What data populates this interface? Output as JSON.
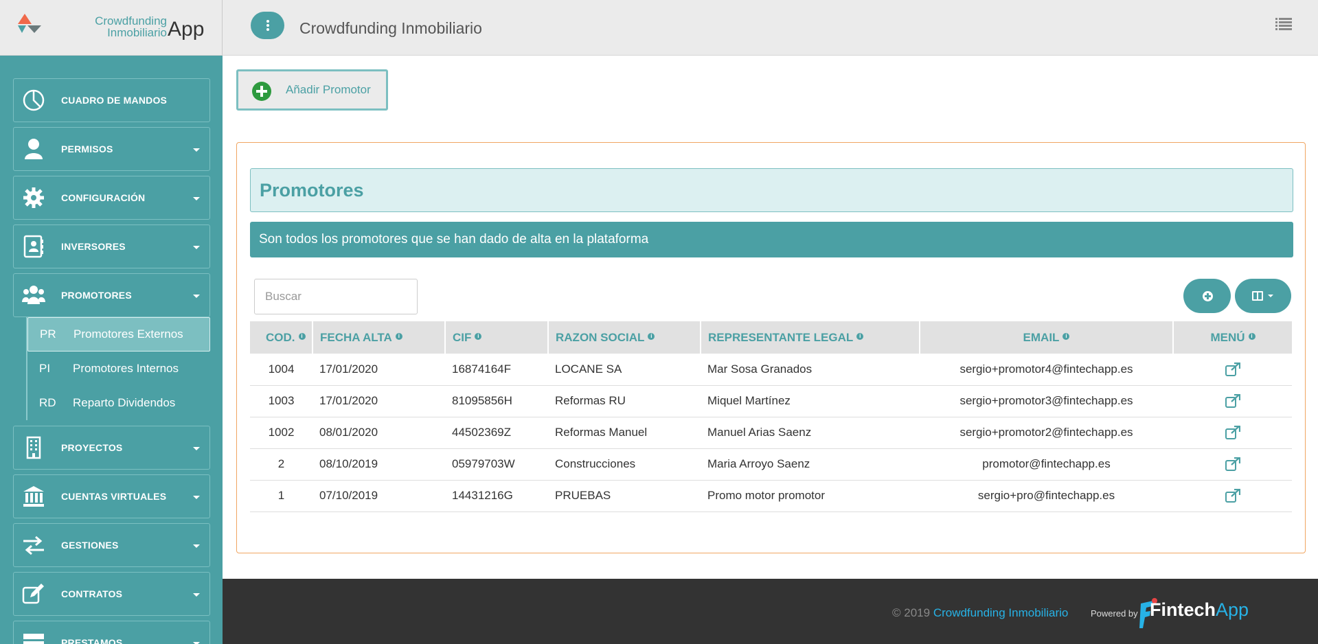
{
  "brand": {
    "line1": "Crowdfunding",
    "line2": "Inmobiliario",
    "app": "App"
  },
  "topbar": {
    "title": "Crowdfunding Inmobiliario"
  },
  "sidebar": {
    "items": [
      {
        "label": "CUADRO DE MANDOS",
        "icon": "dashboard-icon"
      },
      {
        "label": "PERMISOS",
        "icon": "user-icon"
      },
      {
        "label": "CONFIGURACIÓN",
        "icon": "gear-icon"
      },
      {
        "label": "INVERSORES",
        "icon": "contact-book-icon"
      },
      {
        "label": "PROMOTORES",
        "icon": "users-icon"
      },
      {
        "label": "PROYECTOS",
        "icon": "building-icon"
      },
      {
        "label": "CUENTAS VIRTUALES",
        "icon": "bank-icon"
      },
      {
        "label": "GESTIONES",
        "icon": "exchange-icon"
      },
      {
        "label": "CONTRATOS",
        "icon": "edit-icon"
      },
      {
        "label": "PRESTAMOS",
        "icon": "server-icon"
      }
    ],
    "sub_items": [
      {
        "abbr": "PR",
        "label": "Promotores Externos",
        "active": true
      },
      {
        "abbr": "PI",
        "label": "Promotores Internos",
        "active": false
      },
      {
        "abbr": "RD",
        "label": "Reparto Dividendos",
        "active": false
      }
    ]
  },
  "main": {
    "add_button": "Añadir Promotor",
    "card_title": "Promotores",
    "card_subtitle": "Son todos los promotores que se han dado de alta en la plataforma",
    "search_placeholder": "Buscar",
    "columns": [
      "COD.",
      "FECHA ALTA",
      "CIF",
      "RAZON SOCIAL",
      "REPRESENTANTE LEGAL",
      "EMAIL",
      "MENÚ"
    ],
    "rows": [
      {
        "cod": "1004",
        "fecha": "17/01/2020",
        "cif": "16874164F",
        "razon": "LOCANE SA",
        "rep": "Mar Sosa Granados",
        "email": "sergio+promotor4@fintechapp.es"
      },
      {
        "cod": "1003",
        "fecha": "17/01/2020",
        "cif": "81095856H",
        "razon": "Reformas RU",
        "rep": "Miquel Martínez",
        "email": "sergio+promotor3@fintechapp.es"
      },
      {
        "cod": "1002",
        "fecha": "08/01/2020",
        "cif": "44502369Z",
        "razon": "Reformas Manuel",
        "rep": "Manuel Arias Saenz",
        "email": "sergio+promotor2@fintechapp.es"
      },
      {
        "cod": "2",
        "fecha": "08/10/2019",
        "cif": "05979703W",
        "razon": "Construcciones",
        "rep": "Maria Arroyo Saenz",
        "email": "promotor@fintechapp.es"
      },
      {
        "cod": "1",
        "fecha": "07/10/2019",
        "cif": "14431216G",
        "razon": "PRUEBAS",
        "rep": "Promo motor promotor",
        "email": "sergio+pro@fintechapp.es"
      }
    ]
  },
  "footer": {
    "copyright": "© 2019",
    "link": "Crowdfunding Inmobiliario",
    "powered": "Powered by",
    "fintech_a": "Fintech",
    "fintech_b": "App"
  },
  "colors": {
    "accent": "#4ba0a4",
    "border_orange": "#f0a561",
    "footer_bg": "#333333",
    "link_blue": "#27b2e6"
  }
}
